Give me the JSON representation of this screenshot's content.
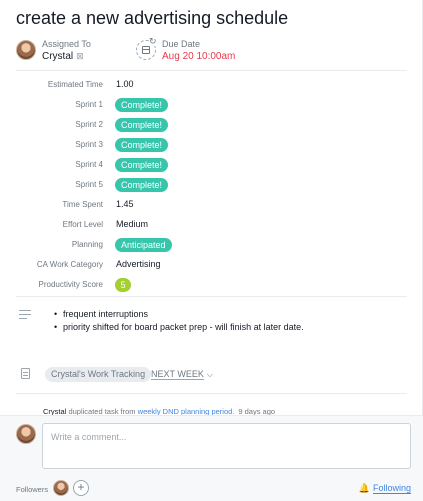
{
  "task": {
    "title": "create a new advertising schedule"
  },
  "assignee": {
    "label": "Assigned To",
    "name": "Crystal",
    "icon": "user-avatar"
  },
  "due": {
    "label": "Due Date",
    "value": "Aug 20 10:00am",
    "icon": "calendar-repeat-icon",
    "color": "#e8384f"
  },
  "fields": [
    {
      "label": "Estimated Time",
      "value": "1.00",
      "kind": "text"
    },
    {
      "label": "Sprint 1",
      "value": "Complete!",
      "kind": "pill"
    },
    {
      "label": "Sprint 2",
      "value": "Complete!",
      "kind": "pill"
    },
    {
      "label": "Sprint 3",
      "value": "Complete!",
      "kind": "pill"
    },
    {
      "label": "Sprint 4",
      "value": "Complete!",
      "kind": "pill"
    },
    {
      "label": "Sprint 5",
      "value": "Complete!",
      "kind": "pill"
    },
    {
      "label": "Time Spent",
      "value": "1.45",
      "kind": "text"
    },
    {
      "label": "Effort Level",
      "value": "Medium",
      "kind": "text"
    },
    {
      "label": "Planning",
      "value": "Anticipated",
      "kind": "pill"
    },
    {
      "label": "CA Work Category",
      "value": "Advertising",
      "kind": "text"
    },
    {
      "label": "Productivity Score",
      "value": "5",
      "kind": "score"
    }
  ],
  "colors": {
    "pill": "#37c5ab",
    "score": "#a4cf30",
    "link": "#4186e0"
  },
  "description": {
    "icon": "description-lines-icon",
    "items": [
      "frequent interruptions",
      "priority shifted for board packet prep - will finish at later date."
    ]
  },
  "project": {
    "icon": "project-clipboard-icon",
    "name": "Crystal's Work Tracking",
    "section": "NEXT WEEK"
  },
  "story": {
    "actor": "Crystal",
    "action": "duplicated task from",
    "source": "weekly DND planning period.",
    "ago": "9 days ago"
  },
  "composer": {
    "placeholder": "Write a comment..."
  },
  "followers": {
    "label": "Followers",
    "following_label": "Following"
  }
}
